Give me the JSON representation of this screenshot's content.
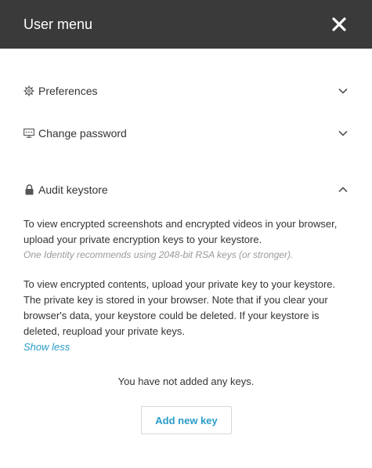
{
  "header": {
    "title": "User menu",
    "close_icon": "close-icon"
  },
  "sections": [
    {
      "label": "Preferences",
      "icon": "gear-icon",
      "expanded": false
    },
    {
      "label": "Change password",
      "icon": "monitor-icon",
      "expanded": false
    },
    {
      "label": "Audit keystore",
      "icon": "lock-icon",
      "expanded": true
    }
  ],
  "keystore": {
    "intro": "To view encrypted screenshots and encrypted videos in your browser, upload your private encryption keys to your keystore.",
    "note": "One Identity recommends using 2048-bit RSA keys (or stronger).",
    "details": "To view encrypted contents, upload your private key to your keystore. The private key is stored in your browser. Note that if you clear your browser's data, your keystore could be deleted. If your keystore is deleted, reupload your private keys.",
    "show_less": "Show less",
    "empty_message": "You have not added any keys.",
    "add_button": "Add new key"
  },
  "colors": {
    "header_bg": "#3a3a3a",
    "link": "#2a9cc8"
  }
}
